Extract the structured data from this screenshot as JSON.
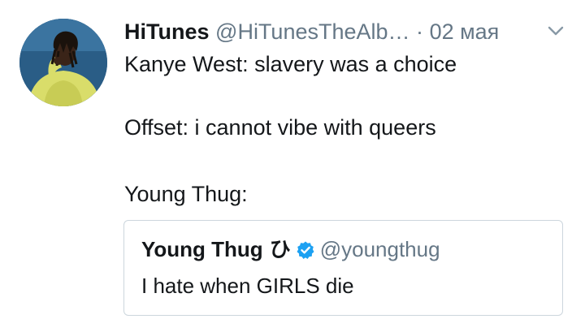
{
  "tweet": {
    "author": {
      "display_name": "HiTunes",
      "handle": "@HiTunesTheAlb…",
      "avatar_icon": "profile-photo"
    },
    "separator": "·",
    "date": "02 мая",
    "menu_icon": "chevron-down-icon",
    "lines": [
      "Kanye West: slavery was a choice",
      "Offset: i cannot vibe with queers",
      "Young Thug:"
    ],
    "quoted": {
      "display_name": "Young Thug",
      "name_glyph": "ひ",
      "verified_icon": "verified-badge-icon",
      "handle": "@youngthug",
      "text": "I hate when GIRLS die"
    }
  },
  "colors": {
    "text_primary": "#14171a",
    "text_secondary": "#657786",
    "verified_blue": "#1da1f2",
    "border": "#ccd6dd"
  }
}
